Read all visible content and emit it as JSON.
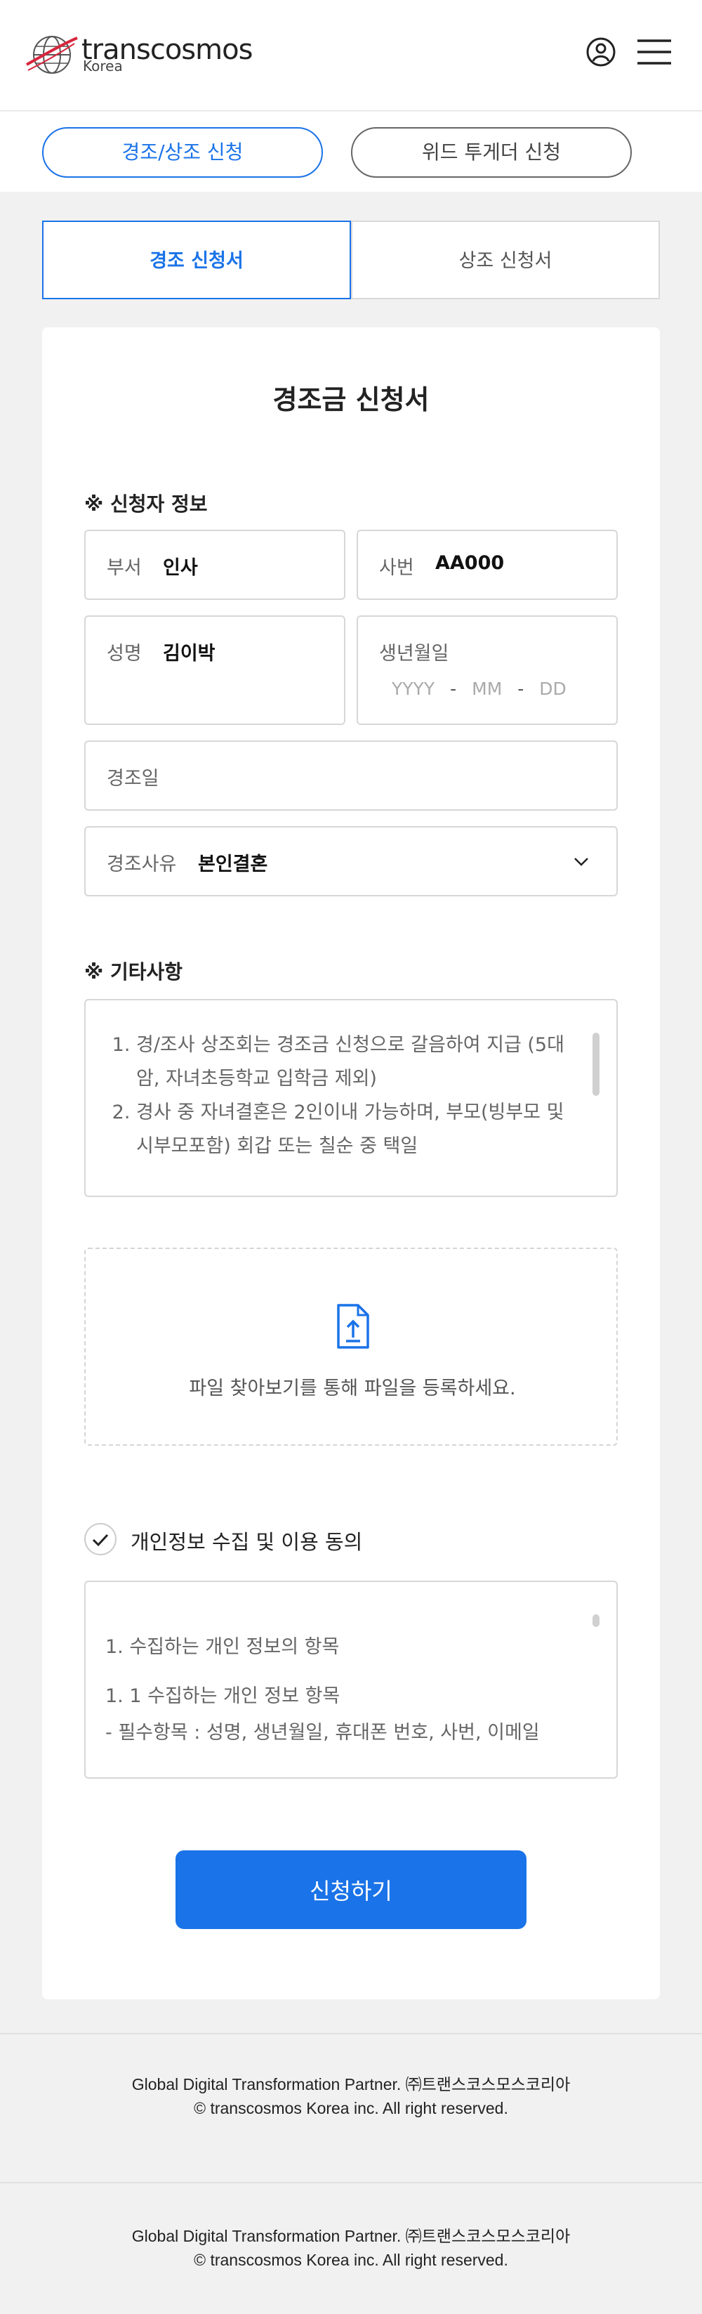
{
  "header": {
    "logo_name": "transcosmos",
    "logo_sub": "Korea",
    "user_icon": "user-circle-icon",
    "menu_icon": "hamburger-menu-icon"
  },
  "top_tabs": [
    {
      "label": "경조/상조 신청",
      "active": true
    },
    {
      "label": "위드 투게더 신청",
      "active": false
    }
  ],
  "sub_tabs": [
    {
      "label": "경조 신청서",
      "active": true
    },
    {
      "label": "상조 신청서",
      "active": false
    }
  ],
  "form": {
    "title": "경조금 신청서",
    "applicant_section": "※ 신청자 정보",
    "department": {
      "label": "부서",
      "value": "인사"
    },
    "employee_no": {
      "label": "사번",
      "value": "AA000"
    },
    "name": {
      "label": "성명",
      "value": "김이박"
    },
    "birth": {
      "label": "생년월일",
      "yyyy": "YYYY",
      "mm": "MM",
      "dd": "DD",
      "sep": "-"
    },
    "event_date": {
      "label": "경조일"
    },
    "reason": {
      "label": "경조사유",
      "value": "본인결혼",
      "icon": "chevron-down-icon"
    },
    "etc_section": "※ 기타사항",
    "notes": [
      "경/조사 상조회는 경조금 신청으로 갈음하여 지급 (5대암, 자녀초등학교 입학금 제외)",
      "경사 중 자녀결혼은 2인이내 가능하며, 부모(빙부모 및 시부모포함) 회갑 또는 칠순 중 택일"
    ],
    "upload_text": "파일 찾아보기를 통해 파일을 등록하세요.",
    "upload_icon": "file-upload-icon",
    "consent_label": "개인정보 수집 및 이용 동의",
    "consent_icon": "check-icon",
    "terms": [
      "1. 수집하는 개인 정보의 항목",
      "1. 1 수집하는 개인 정보 항목",
      "- 필수항목 : 성명, 생년월일, 휴대폰 번호, 사번, 이메일"
    ],
    "submit_label": "신청하기"
  },
  "footer": {
    "line1": "Global Digital Transformation Partner. ㈜트랜스코스모스코리아",
    "line2": "© transcosmos Korea inc. All right reserved."
  },
  "colors": {
    "accent": "#1a73e8",
    "logo_red": "#d7263d",
    "border": "#d7d7d7",
    "background": "#f1f1f1"
  }
}
